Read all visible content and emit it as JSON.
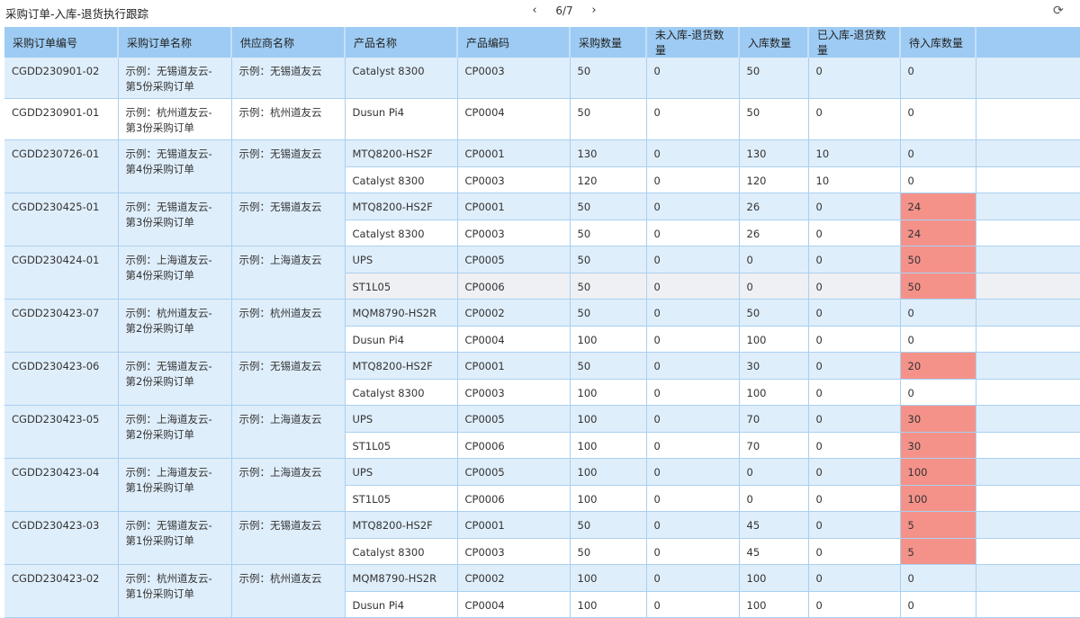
{
  "header": {
    "title": "采购订单-入库-退货执行跟踪",
    "page": "6/7",
    "prev_icon": "‹",
    "next_icon": "›"
  },
  "columns": [
    "采购订单编号",
    "采购订单名称",
    "供应商名称",
    "产品名称",
    "产品编码",
    "采购数量",
    "未入库-退货数量",
    "入库数量",
    "已入库-退货数量",
    "待入库数量"
  ],
  "colors": {
    "header": "#9dcbf3",
    "row_alt": "#dfeefb",
    "alert": "#f4928a"
  },
  "orders": [
    {
      "id": "CGDD230901-02",
      "name": "示例：无锡道友云-第5份采购订单",
      "supplier": "示例：无锡道友云",
      "items": [
        [
          "Catalyst 8300",
          "CP0003",
          "50",
          "0",
          "50",
          "0",
          "0"
        ]
      ]
    },
    {
      "id": "CGDD230901-01",
      "name": "示例：杭州道友云-第3份采购订单",
      "supplier": "示例：杭州道友云",
      "items": [
        [
          "Dusun Pi4",
          "CP0004",
          "50",
          "0",
          "50",
          "0",
          "0"
        ]
      ]
    },
    {
      "id": "CGDD230726-01",
      "name": "示例：无锡道友云-第4份采购订单",
      "supplier": "示例：无锡道友云",
      "items": [
        [
          "MTQ8200-HS2F",
          "CP0001",
          "130",
          "0",
          "130",
          "10",
          "0"
        ],
        [
          "Catalyst 8300",
          "CP0003",
          "120",
          "0",
          "120",
          "10",
          "0"
        ]
      ]
    },
    {
      "id": "CGDD230425-01",
      "name": "示例：无锡道友云-第3份采购订单",
      "supplier": "示例：无锡道友云",
      "items": [
        [
          "MTQ8200-HS2F",
          "CP0001",
          "50",
          "0",
          "26",
          "0",
          "24"
        ],
        [
          "Catalyst 8300",
          "CP0003",
          "50",
          "0",
          "26",
          "0",
          "24"
        ]
      ]
    },
    {
      "id": "CGDD230424-01",
      "name": "示例：上海道友云-第4份采购订单",
      "supplier": "示例：上海道友云",
      "items": [
        [
          "UPS",
          "CP0005",
          "50",
          "0",
          "0",
          "0",
          "50"
        ],
        [
          "ST1L05",
          "CP0006",
          "50",
          "0",
          "0",
          "0",
          "50"
        ]
      ]
    },
    {
      "id": "CGDD230423-07",
      "name": "示例：杭州道友云-第2份采购订单",
      "supplier": "示例：杭州道友云",
      "items": [
        [
          "MQM8790-HS2R",
          "CP0002",
          "50",
          "0",
          "50",
          "0",
          "0"
        ],
        [
          "Dusun Pi4",
          "CP0004",
          "100",
          "0",
          "100",
          "0",
          "0"
        ]
      ]
    },
    {
      "id": "CGDD230423-06",
      "name": "示例：无锡道友云-第2份采购订单",
      "supplier": "示例：无锡道友云",
      "items": [
        [
          "MTQ8200-HS2F",
          "CP0001",
          "50",
          "0",
          "30",
          "0",
          "20"
        ],
        [
          "Catalyst 8300",
          "CP0003",
          "100",
          "0",
          "100",
          "0",
          "0"
        ]
      ]
    },
    {
      "id": "CGDD230423-05",
      "name": "示例：上海道友云-第2份采购订单",
      "supplier": "示例：上海道友云",
      "items": [
        [
          "UPS",
          "CP0005",
          "100",
          "0",
          "70",
          "0",
          "30"
        ],
        [
          "ST1L05",
          "CP0006",
          "100",
          "0",
          "70",
          "0",
          "30"
        ]
      ]
    },
    {
      "id": "CGDD230423-04",
      "name": "示例：上海道友云-第1份采购订单",
      "supplier": "示例：上海道友云",
      "items": [
        [
          "UPS",
          "CP0005",
          "100",
          "0",
          "0",
          "0",
          "100"
        ],
        [
          "ST1L05",
          "CP0006",
          "100",
          "0",
          "0",
          "0",
          "100"
        ]
      ]
    },
    {
      "id": "CGDD230423-03",
      "name": "示例：无锡道友云-第1份采购订单",
      "supplier": "示例：无锡道友云",
      "items": [
        [
          "MTQ8200-HS2F",
          "CP0001",
          "50",
          "0",
          "45",
          "0",
          "5"
        ],
        [
          "Catalyst 8300",
          "CP0003",
          "50",
          "0",
          "45",
          "0",
          "5"
        ]
      ]
    },
    {
      "id": "CGDD230423-02",
      "name": "示例：杭州道友云-第1份采购订单",
      "supplier": "示例：杭州道友云",
      "items": [
        [
          "MQM8790-HS2R",
          "CP0002",
          "100",
          "0",
          "100",
          "0",
          "0"
        ],
        [
          "Dusun Pi4",
          "CP0004",
          "100",
          "0",
          "100",
          "0",
          "0"
        ]
      ]
    }
  ]
}
